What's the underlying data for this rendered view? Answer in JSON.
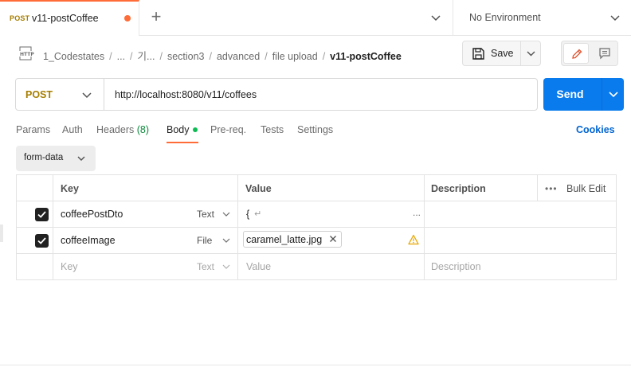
{
  "tab": {
    "method": "POST",
    "name": "v11-postCoffee"
  },
  "environment": {
    "label": "No Environment"
  },
  "breadcrumb": {
    "items": [
      "1_Codestates",
      "...",
      "기...",
      "section3",
      "advanced",
      "file upload"
    ],
    "separator": "/",
    "current": "v11-postCoffee"
  },
  "toolbar": {
    "save_label": "Save"
  },
  "request": {
    "method": "POST",
    "url": "http://localhost:8080/v11/coffees",
    "send_label": "Send"
  },
  "request_tabs": {
    "params": "Params",
    "auth": "Auth",
    "headers": "Headers",
    "headers_count": "(8)",
    "body": "Body",
    "prereq": "Pre-req.",
    "tests": "Tests",
    "settings": "Settings",
    "cookies": "Cookies"
  },
  "body_type": {
    "selected": "form-data"
  },
  "table": {
    "headers": {
      "key": "Key",
      "value": "Value",
      "description": "Description",
      "bulk_edit": "Bulk Edit",
      "bulk_dots": "•••"
    },
    "rows": [
      {
        "checked": true,
        "key": "coffeePostDto",
        "type": "Text",
        "value": "{",
        "value_return": "↵",
        "value_more": "..."
      },
      {
        "checked": true,
        "key": "coffeeImage",
        "type": "File",
        "file_name": "caramel_latte.jpg"
      }
    ],
    "placeholder": {
      "key": "Key",
      "type": "Text",
      "value": "Value",
      "description": "Description"
    }
  },
  "colors": {
    "accent": "#ff6c37",
    "post_method": "#a67e00",
    "send_blue": "#097bed",
    "cookies_link": "#0265d2",
    "status_green": "#0cbb52",
    "warning": "#e8a600"
  },
  "icons": {
    "http": "http-file-icon",
    "save": "floppy-disk-icon",
    "edit": "pencil-icon",
    "docs": "comment-doc-icon",
    "warning": "warning-triangle-icon"
  }
}
